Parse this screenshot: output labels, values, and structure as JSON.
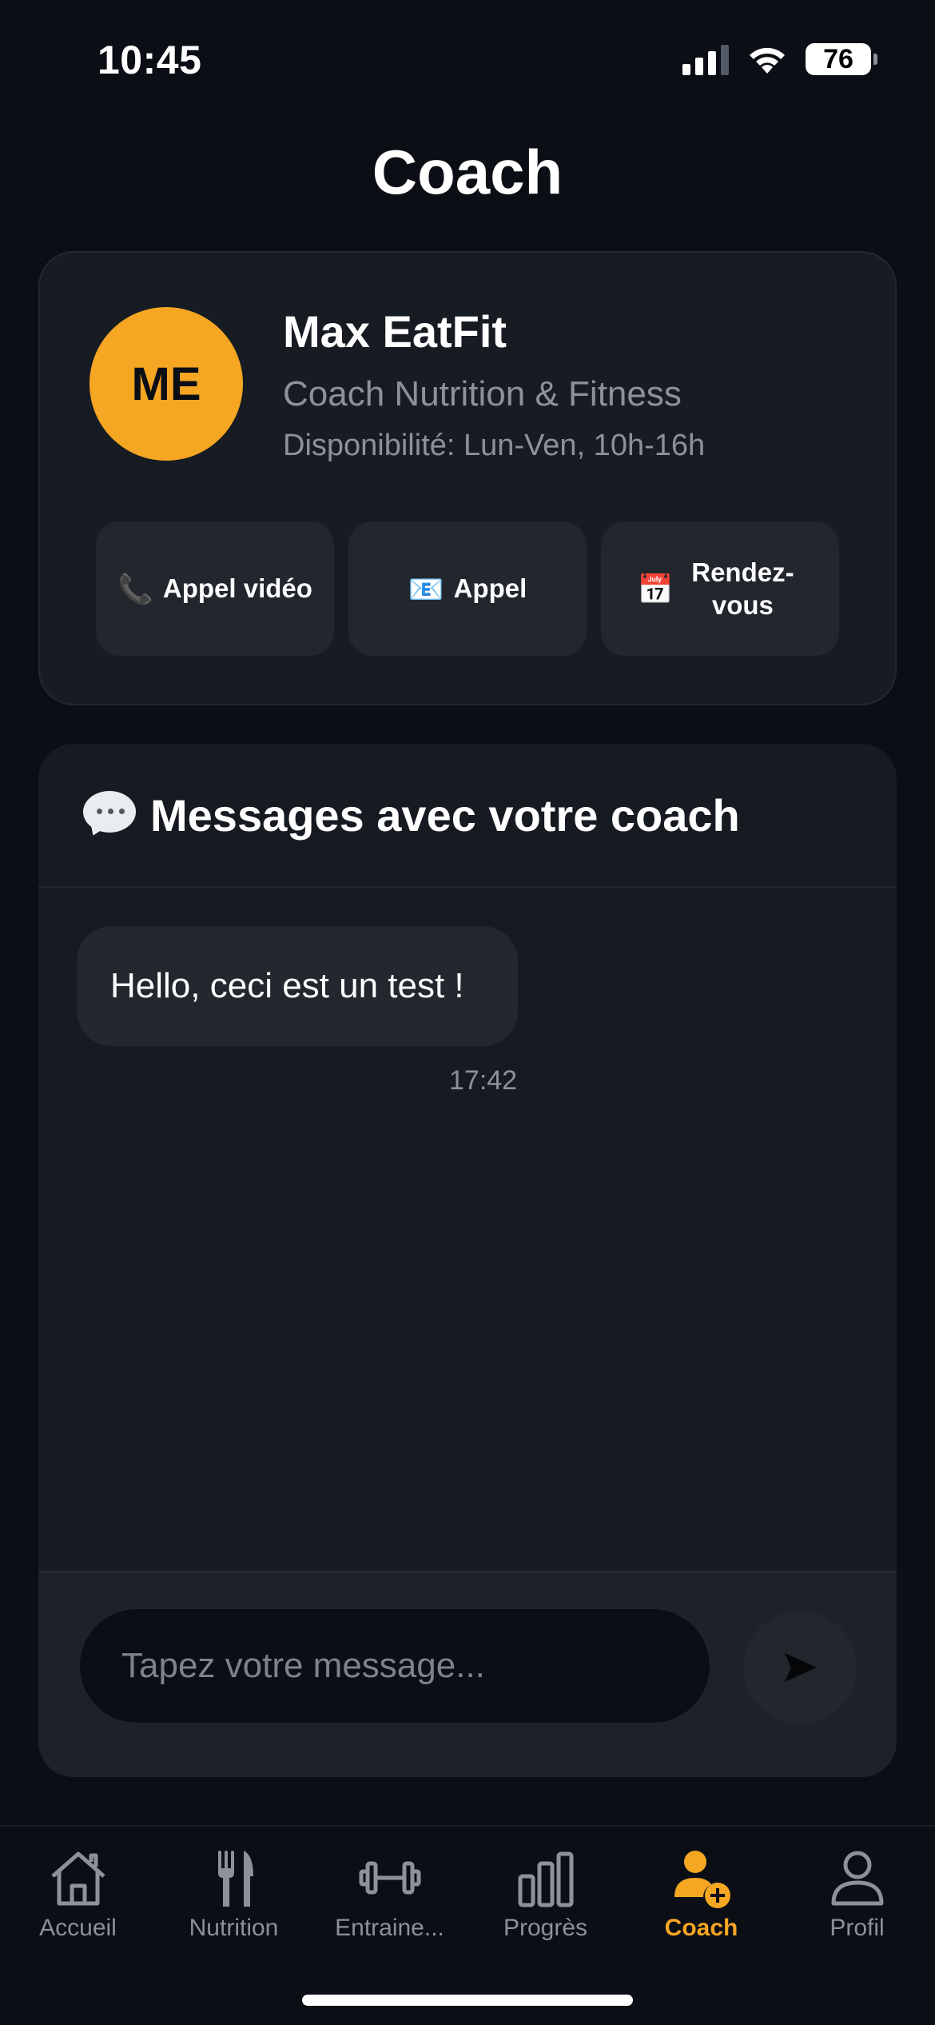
{
  "status_bar": {
    "time": "10:45",
    "battery": "76",
    "battery_level": 0.76
  },
  "page": {
    "title": "Coach"
  },
  "coach": {
    "initials": "ME",
    "name": "Max EatFit",
    "role": "Coach Nutrition & Fitness",
    "availability": "Disponibilité: Lun-Ven, 10h-16h",
    "avatar_color": "#f5a623",
    "actions": [
      {
        "icon": "📞",
        "label": "Appel vidéo"
      },
      {
        "icon": "📧",
        "label": "Appel"
      },
      {
        "icon": "📅",
        "label": "Rendez-vous"
      }
    ]
  },
  "messages": {
    "title": "Messages avec votre coach",
    "items": [
      {
        "text": "Hello, ceci est un test !",
        "time": "17:42"
      }
    ],
    "input_placeholder": "Tapez votre message...",
    "send_icon": "➤"
  },
  "tab_bar": {
    "active_color": "#f5a623",
    "tabs": [
      {
        "label": "Accueil",
        "icon": "home-icon"
      },
      {
        "label": "Nutrition",
        "icon": "fork-knife-icon"
      },
      {
        "label": "Entraine...",
        "icon": "dumbbell-icon"
      },
      {
        "label": "Progrès",
        "icon": "bar-chart-icon"
      },
      {
        "label": "Coach",
        "icon": "person-add-icon",
        "active": true
      },
      {
        "label": "Profil",
        "icon": "person-icon"
      }
    ]
  }
}
